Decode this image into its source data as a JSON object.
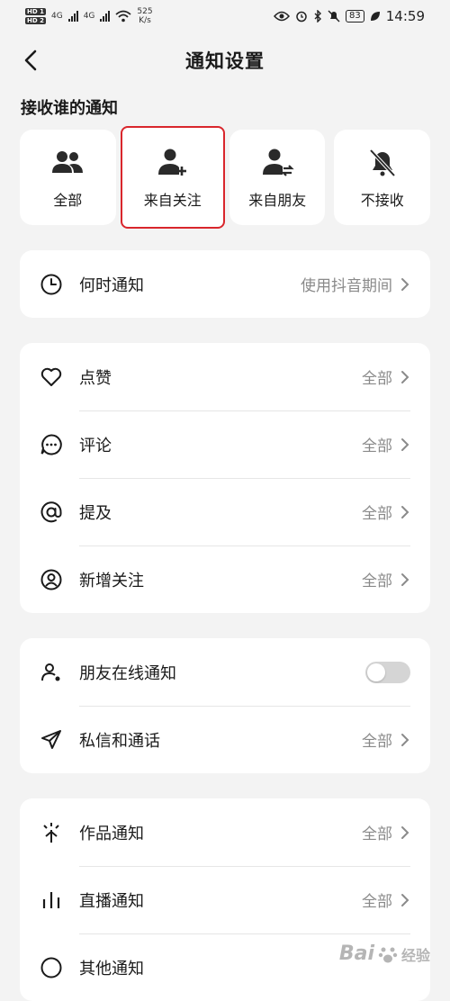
{
  "status_bar": {
    "hd1": "HD 1",
    "hd2": "HD 2",
    "net1": "4G",
    "net2": "4G",
    "speed": "525",
    "speed_unit": "K/s",
    "battery": "83",
    "time": "14:59"
  },
  "header": {
    "title": "通知设置"
  },
  "receive_section": {
    "label": "接收谁的通知",
    "options": [
      {
        "label": "全部",
        "icon": "group-icon"
      },
      {
        "label": "来自关注",
        "icon": "user-add-icon",
        "selected": true
      },
      {
        "label": "来自朋友",
        "icon": "user-swap-icon"
      },
      {
        "label": "不接收",
        "icon": "bell-off-icon"
      }
    ]
  },
  "when_group": {
    "rows": [
      {
        "label": "何时通知",
        "value": "使用抖音期间",
        "icon": "clock-icon"
      }
    ]
  },
  "interaction_group": {
    "rows": [
      {
        "label": "点赞",
        "value": "全部",
        "icon": "heart-icon"
      },
      {
        "label": "评论",
        "value": "全部",
        "icon": "comment-icon"
      },
      {
        "label": "提及",
        "value": "全部",
        "icon": "at-icon"
      },
      {
        "label": "新增关注",
        "value": "全部",
        "icon": "user-circle-icon"
      }
    ]
  },
  "social_group": {
    "rows": [
      {
        "label": "朋友在线通知",
        "icon": "user-online-icon",
        "toggle_on": false
      },
      {
        "label": "私信和通话",
        "value": "全部",
        "icon": "send-icon"
      }
    ]
  },
  "content_group": {
    "rows": [
      {
        "label": "作品通知",
        "value": "全部",
        "icon": "sparkle-icon"
      },
      {
        "label": "直播通知",
        "value": "全部",
        "icon": "bars-icon"
      },
      {
        "label": "其他通知",
        "icon": "circle-icon"
      }
    ]
  },
  "watermark": {
    "brand": "Bai",
    "suffix": "经验"
  },
  "colors": {
    "background": "#f3f3f3",
    "card": "#ffffff",
    "selected_border": "#d9262c",
    "secondary_text": "#8a8a8a"
  }
}
